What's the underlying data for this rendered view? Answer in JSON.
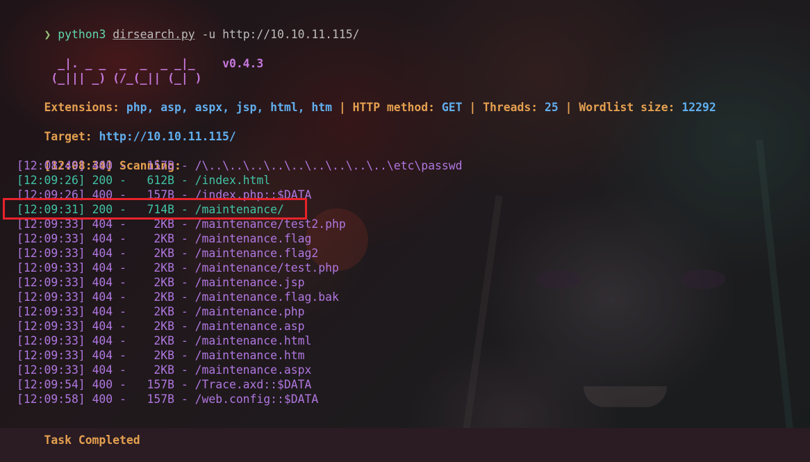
{
  "command": {
    "prompt": "❯",
    "program": "python3",
    "script": "dirsearch.py",
    "args": "-u http://10.10.11.115/"
  },
  "banner": {
    "logo_line1": "  _|. _ _  _  _  _ _|_",
    "logo_line2": " (_||| _) (/_(_|| (_| )",
    "version": "v0.4.3"
  },
  "config": {
    "extensions_label": "Extensions:",
    "extensions_value": "php, asp, aspx, jsp, html, htm",
    "method_label": "HTTP method:",
    "method_value": "GET",
    "threads_label": "Threads:",
    "threads_value": "25",
    "wordlist_label": "Wordlist size:",
    "wordlist_value": "12292",
    "separator": "|"
  },
  "target": {
    "label": "Target:",
    "url": "http://10.10.11.115/"
  },
  "scan_start": {
    "time": "[12:08:34]",
    "text": "Scanning:"
  },
  "results": [
    {
      "time": "[12:08:49]",
      "status": "400",
      "size": "157B",
      "path": "/\\..\\..\\..\\..\\..\\..\\..\\..\\..\\etc\\passwd"
    },
    {
      "time": "[12:09:26]",
      "status": "200",
      "size": "612B",
      "path": "/index.html"
    },
    {
      "time": "[12:09:26]",
      "status": "400",
      "size": "157B",
      "path": "/index.php::$DATA"
    },
    {
      "time": "[12:09:31]",
      "status": "200",
      "size": "714B",
      "path": "/maintenance/"
    },
    {
      "time": "[12:09:33]",
      "status": "404",
      "size": "2KB",
      "path": "/maintenance/test2.php"
    },
    {
      "time": "[12:09:33]",
      "status": "404",
      "size": "2KB",
      "path": "/maintenance.flag"
    },
    {
      "time": "[12:09:33]",
      "status": "404",
      "size": "2KB",
      "path": "/maintenance.flag2"
    },
    {
      "time": "[12:09:33]",
      "status": "404",
      "size": "2KB",
      "path": "/maintenance/test.php"
    },
    {
      "time": "[12:09:33]",
      "status": "404",
      "size": "2KB",
      "path": "/maintenance.jsp"
    },
    {
      "time": "[12:09:33]",
      "status": "404",
      "size": "2KB",
      "path": "/maintenance.flag.bak"
    },
    {
      "time": "[12:09:33]",
      "status": "404",
      "size": "2KB",
      "path": "/maintenance.php"
    },
    {
      "time": "[12:09:33]",
      "status": "404",
      "size": "2KB",
      "path": "/maintenance.asp"
    },
    {
      "time": "[12:09:33]",
      "status": "404",
      "size": "2KB",
      "path": "/maintenance.html"
    },
    {
      "time": "[12:09:33]",
      "status": "404",
      "size": "2KB",
      "path": "/maintenance.htm"
    },
    {
      "time": "[12:09:33]",
      "status": "404",
      "size": "2KB",
      "path": "/maintenance.aspx"
    },
    {
      "time": "[12:09:54]",
      "status": "400",
      "size": "157B",
      "path": "/Trace.axd::$DATA"
    },
    {
      "time": "[12:09:58]",
      "status": "400",
      "size": "157B",
      "path": "/web.config::$DATA"
    }
  ],
  "footer": {
    "text": "Task Completed"
  },
  "colors": {
    "status_200": "#41c3a5",
    "status_400": "#b077e0",
    "status_404": "#b077e0",
    "label": "#e5a050",
    "value": "#61afef",
    "highlight_box": "#e8232b"
  }
}
